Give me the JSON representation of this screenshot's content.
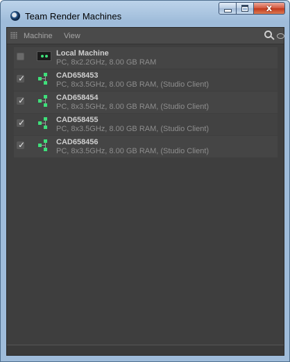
{
  "window": {
    "title": "Team Render Machines",
    "close_symbol": "x",
    "icon": "cinema4d-icon"
  },
  "menubar": {
    "items": [
      "Machine",
      "View"
    ],
    "icons": [
      "grip-icon",
      "search-icon",
      "eye-icon"
    ]
  },
  "machines": [
    {
      "checked": false,
      "icon": "monitor-icon",
      "name": "Local Machine",
      "details": "PC, 8x2.2GHz, 8.00 GB RAM"
    },
    {
      "checked": true,
      "icon": "network-node-icon",
      "name": "CAD658453",
      "details": "PC, 8x3.5GHz, 8.00 GB RAM, (Studio Client)"
    },
    {
      "checked": true,
      "icon": "network-node-icon",
      "name": "CAD658454",
      "details": "PC, 8x3.5GHz, 8.00 GB RAM, (Studio Client)"
    },
    {
      "checked": true,
      "icon": "network-node-icon",
      "name": "CAD658455",
      "details": "PC, 8x3.5GHz, 8.00 GB RAM, (Studio Client)"
    },
    {
      "checked": true,
      "icon": "network-node-icon",
      "name": "CAD658456",
      "details": "PC, 8x3.5GHz, 8.00 GB RAM, (Studio Client)"
    }
  ],
  "colors": {
    "panel_background": "#3e3e3e",
    "status_green": "#3ee07a",
    "titlebar": "#9fbcda"
  }
}
